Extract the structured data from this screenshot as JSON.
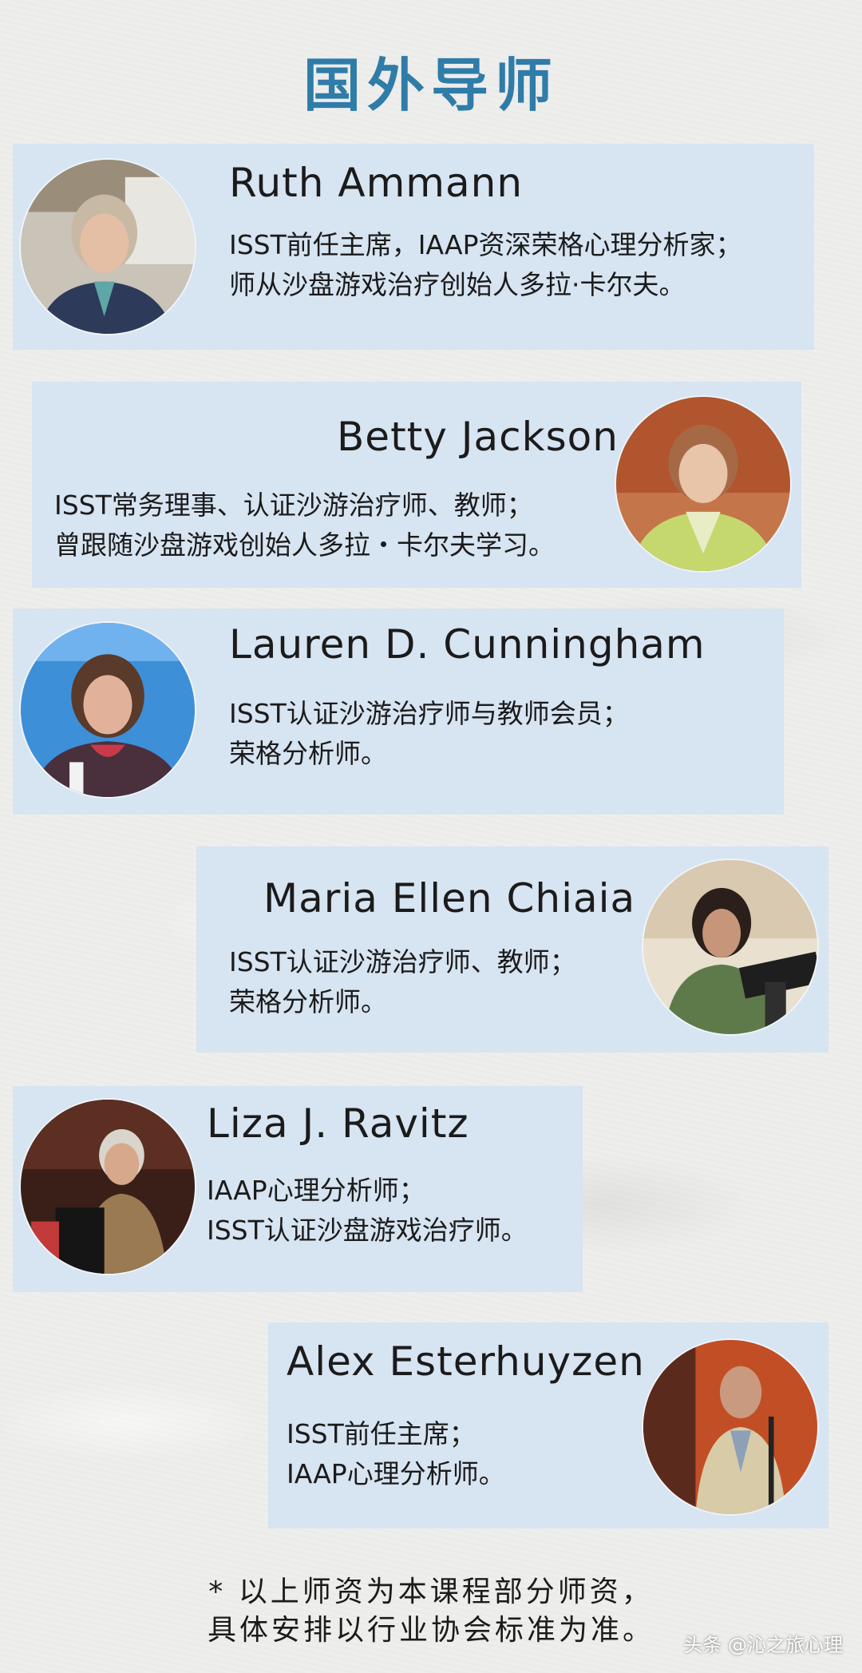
{
  "title": "国外导师",
  "mentors": [
    {
      "name": "Ruth Ammann",
      "lines": [
        "ISST前任主席，IAAP资深荣格心理分析家；",
        "师从沙盘游戏治疗创始人多拉·卡尔夫。"
      ]
    },
    {
      "name": "Betty Jackson",
      "lines": [
        "ISST常务理事、认证沙游治疗师、教师；",
        "曾跟随沙盘游戏创始人多拉・卡尔夫学习。"
      ]
    },
    {
      "name": "Lauren D. Cunningham",
      "lines": [
        "ISST认证沙游治疗师与教师会员；",
        "荣格分析师。"
      ]
    },
    {
      "name": "Maria Ellen Chiaia",
      "lines": [
        "ISST认证沙游治疗师、教师；",
        "荣格分析师。"
      ]
    },
    {
      "name": "Liza J. Ravitz",
      "lines": [
        "IAAP心理分析师；",
        "ISST认证沙盘游戏治疗师。"
      ]
    },
    {
      "name": "Alex Esterhuyzen",
      "lines": [
        "ISST前任主席；",
        "IAAP心理分析师。"
      ]
    }
  ],
  "footnote": {
    "line1": "* 以上师资为本课程部分师资，",
    "line2": "具体安排以行业协会标准为准。"
  },
  "watermark": "头条 @沁之旅心理",
  "colors": {
    "title": "#2f7ca8",
    "card": "#d7e4f1",
    "background": "#eeeeec"
  }
}
